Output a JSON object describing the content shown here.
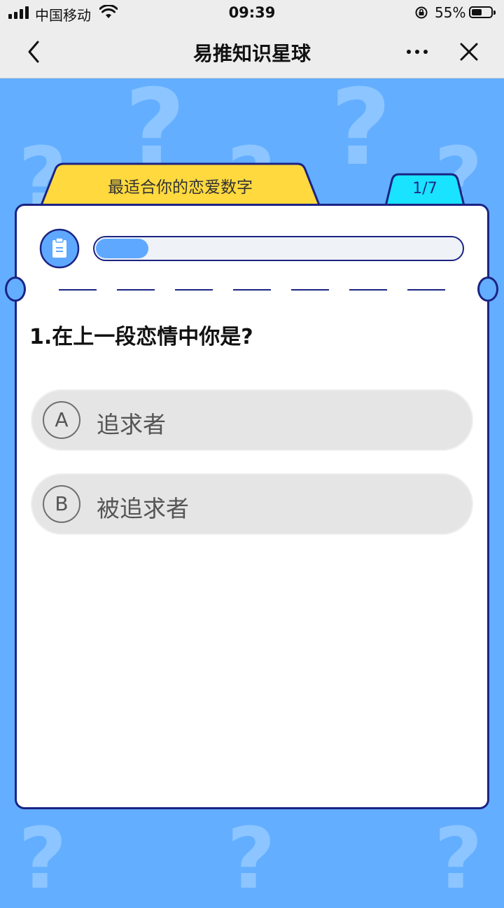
{
  "status_bar": {
    "carrier": "中国移动",
    "time": "09:39",
    "battery_percent": "55%",
    "battery_level": 0.55,
    "icons": [
      "signal-icon",
      "wifi-icon",
      "rotation-lock-icon",
      "battery-icon"
    ]
  },
  "nav": {
    "title": "易推知识星球",
    "back_icon": "chevron-left-icon",
    "more_icon": "more-dots-icon",
    "close_icon": "close-icon"
  },
  "quiz": {
    "tab_title": "最适合你的恋爱数字",
    "page_indicator": "1/7",
    "progress_fraction": 0.143,
    "question": "1.在上一段恋情中你是?",
    "options": [
      {
        "letter": "A",
        "text": "追求者"
      },
      {
        "letter": "B",
        "text": "被追求者"
      }
    ]
  },
  "colors": {
    "background": "#63AEFF",
    "card_border": "#1B2483",
    "tab_yellow": "#FFD93E",
    "tab_cyan": "#19E3FF",
    "progress_fill": "#5FA8FF",
    "option_bg": "#E5E5E5"
  }
}
